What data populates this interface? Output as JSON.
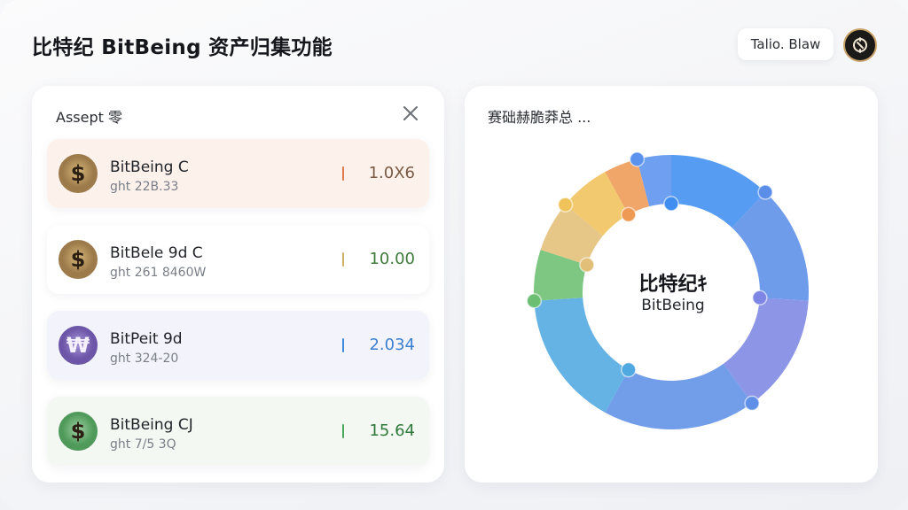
{
  "header": {
    "title": "比特纪 BitBeing 资产归集功能",
    "user_label": "Talio. Blaw"
  },
  "asset_panel": {
    "title": "Assept 零",
    "close_icon": "close-icon",
    "items": [
      {
        "name": "BitBeing C",
        "sub": "ght 22B.33",
        "value": "1.0X6",
        "icon": "dollar-coin-icon",
        "symbol": "$",
        "accent": "#e07a4a",
        "value_color": "#7a5a44",
        "bg": "#fdf1ec",
        "coin_bg": "#9c7a4a",
        "coin_ring": "#d8b77a"
      },
      {
        "name": "BitBele 9d C",
        "sub": "ght 261 8460W",
        "value": "10.00",
        "icon": "dollar-coin-icon",
        "symbol": "$",
        "accent": "#cdb067",
        "value_color": "#3f7a3a",
        "bg": "#ffffff",
        "coin_bg": "#9c7a4a",
        "coin_ring": "#d8b77a"
      },
      {
        "name": "BitPeit 9d",
        "sub": "ght 324-20",
        "value": "2.034",
        "icon": "w-coin-icon",
        "symbol": "₩",
        "accent": "#3f8ad8",
        "value_color": "#3c7fd0",
        "bg": "#f3f4fb",
        "coin_bg": "#6d55a8",
        "coin_ring": "#a896d8"
      },
      {
        "name": "BitBeing CJ",
        "sub": "ght 7/5 3Q",
        "value": "15.64",
        "icon": "dollar-coin-icon",
        "symbol": "$",
        "accent": "#4aa65a",
        "value_color": "#2f7a3a",
        "bg": "#f3f8f3",
        "coin_bg": "#4f9a5a",
        "coin_ring": "#9fd0a4"
      }
    ]
  },
  "chart_panel": {
    "title": "赛础赫脆莽总 ...",
    "center_title": "比特纪ｷ",
    "center_sub": "BitBeing"
  },
  "chart_data": {
    "type": "pie",
    "values": [
      12,
      14,
      14,
      18,
      16,
      6,
      6,
      6,
      4,
      4
    ],
    "colors": [
      "#3f8ef0",
      "#5a8ee8",
      "#7d86e4",
      "#5f8fe6",
      "#4fa8e0",
      "#6cbf72",
      "#e2bf78",
      "#f0c25a",
      "#ee9a54",
      "#5b92ee"
    ]
  }
}
